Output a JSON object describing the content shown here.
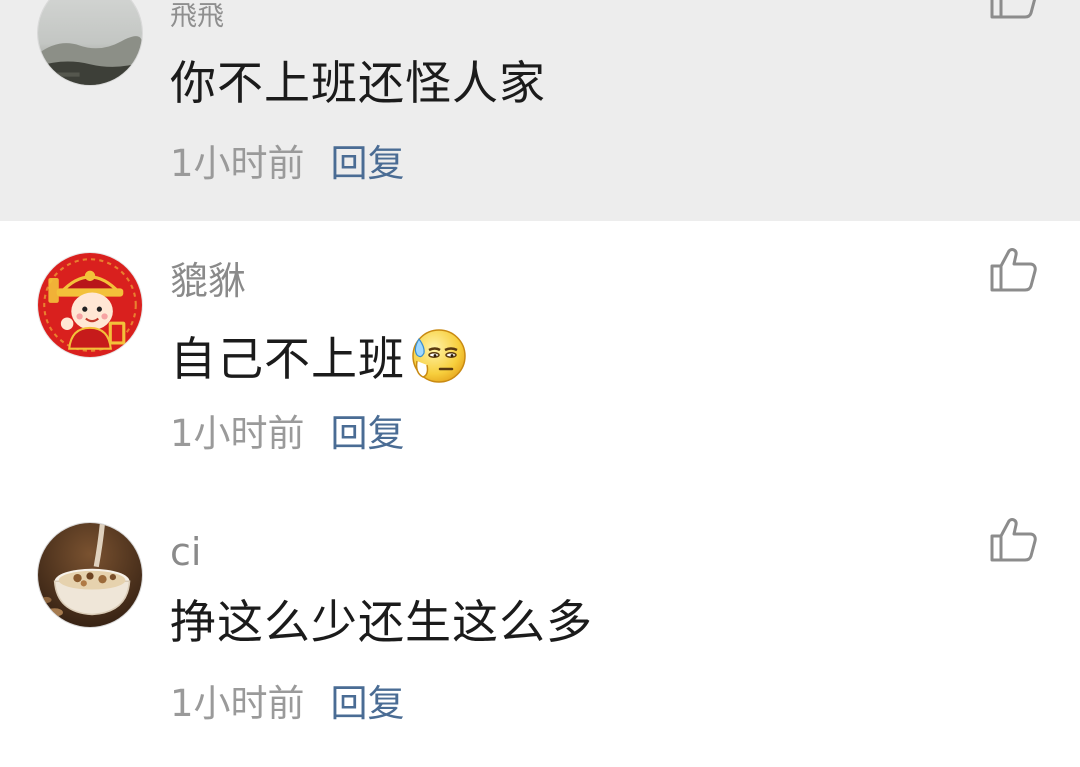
{
  "comments": [
    {
      "username": "飛飛",
      "text": "你不上班还怪人家",
      "time": "1小时前",
      "reply_label": "回复",
      "avatar_icon": "misty-landscape-avatar",
      "like_icon": "thumbs-up-icon",
      "background": "#ededed"
    },
    {
      "username": "貔貅",
      "text": "自己不上班",
      "emoji_icon": "sweating-face-emoji",
      "time": "1小时前",
      "reply_label": "回复",
      "avatar_icon": "god-of-wealth-cartoon-avatar",
      "like_icon": "thumbs-up-icon",
      "background": "#ffffff"
    },
    {
      "username": "ci",
      "text": "挣这么少还生这么多",
      "time": "1小时前",
      "reply_label": "回复",
      "avatar_icon": "cereal-bowl-avatar",
      "like_icon": "thumbs-up-icon",
      "background": "#ffffff"
    }
  ],
  "colors": {
    "reply": "#4a6c94",
    "meta": "#9a9a9a",
    "text": "#1b1b1b",
    "username": "#8a8a8a",
    "highlight_bg": "#ededed"
  }
}
